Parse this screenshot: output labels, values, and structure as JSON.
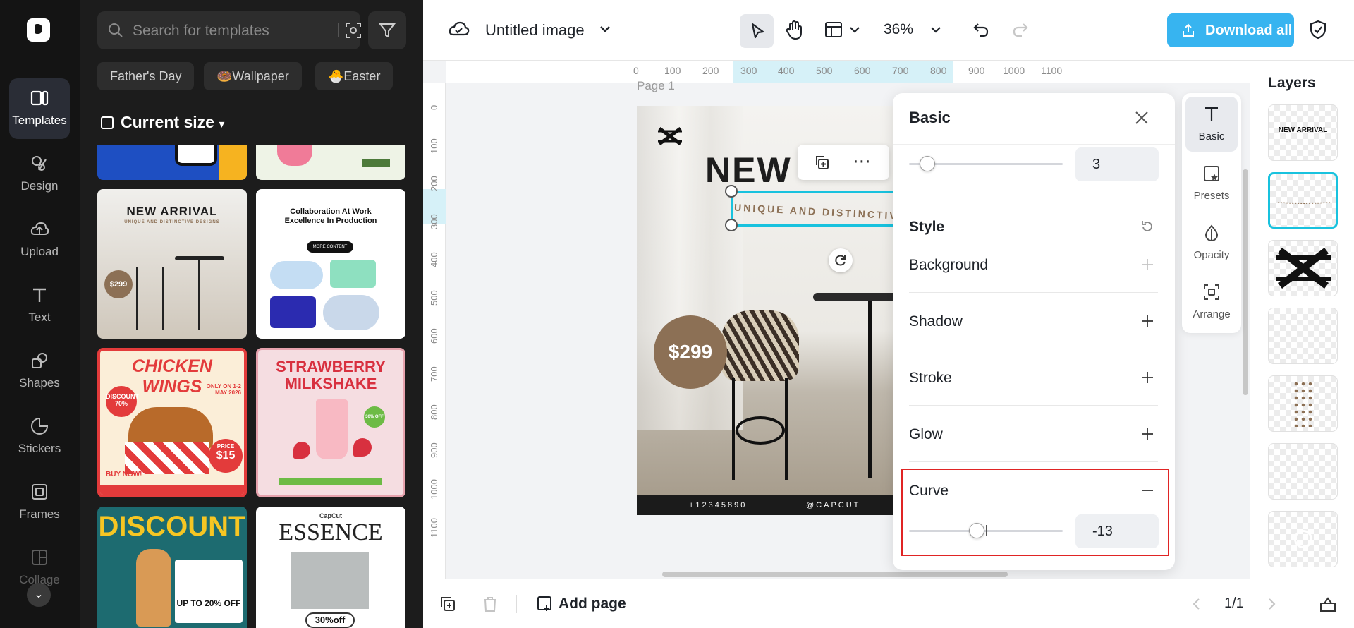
{
  "rail": {
    "items": [
      {
        "label": "Templates"
      },
      {
        "label": "Design"
      },
      {
        "label": "Upload"
      },
      {
        "label": "Text"
      },
      {
        "label": "Shapes"
      },
      {
        "label": "Stickers"
      },
      {
        "label": "Frames"
      },
      {
        "label": "Collage"
      }
    ]
  },
  "panel": {
    "search_placeholder": "Search for templates",
    "chips": [
      "Father's Day",
      "🍩Wallpaper",
      "🐣Easter"
    ],
    "current_size": "Current size",
    "templates": [
      {
        "title": "NEW ARRIVAL",
        "sub": "UNIQUE AND DISTINCTIVE DESIGNS",
        "price": "$299"
      },
      {
        "title": "Collaboration At Work Excellence In Production",
        "button": "MORE CONTENT"
      },
      {
        "title": "CHICKEN WINGS",
        "badge": "DISCOUNT 70%",
        "date": "ONLY ON 1-2 MAY 2026",
        "price_label": "PRICE",
        "price": "$15",
        "cta": "BUY NOW!"
      },
      {
        "title": "STRAWBERRY MILKSHAKE",
        "badge": "30% OFF"
      },
      {
        "title": "DISCOUNT",
        "offer": "UP TO 20% OFF"
      },
      {
        "title": "ESSENCE",
        "brand": "CapCut",
        "offer": "30%off"
      }
    ]
  },
  "topbar": {
    "doc_title": "Untitled image",
    "zoom": "36%",
    "download_label": "Download all"
  },
  "canvas": {
    "page_label": "Page 1",
    "ruler_h": [
      "0",
      "100",
      "200",
      "300",
      "400",
      "500",
      "600",
      "700",
      "800",
      "900",
      "1000",
      "1100"
    ],
    "ruler_v": [
      "0",
      "100",
      "200",
      "300",
      "400",
      "500",
      "600",
      "700",
      "800",
      "900",
      "1000",
      "1100"
    ],
    "headline": "NEW",
    "subline": "UNIQUE AND DISTINCTIVE",
    "price": "$299",
    "footer_left": "+12345890",
    "footer_mid": "@CAPCUT"
  },
  "basic": {
    "title": "Basic",
    "top_value": "3",
    "style_label": "Style",
    "rows": [
      "Background",
      "Shadow",
      "Stroke",
      "Glow"
    ],
    "curve_label": "Curve",
    "curve_value": "-13"
  },
  "sidetabs": [
    "Basic",
    "Presets",
    "Opacity",
    "Arrange"
  ],
  "layers": {
    "title": "Layers",
    "first_text": "NEW ARRIVAL"
  },
  "bottombar": {
    "add_page": "Add page",
    "pager": "1/1"
  },
  "colors": {
    "accent": "#37b4f0",
    "selection": "#18c2de",
    "highlight_box": "#e02424",
    "brand_brown": "#8c7055"
  }
}
